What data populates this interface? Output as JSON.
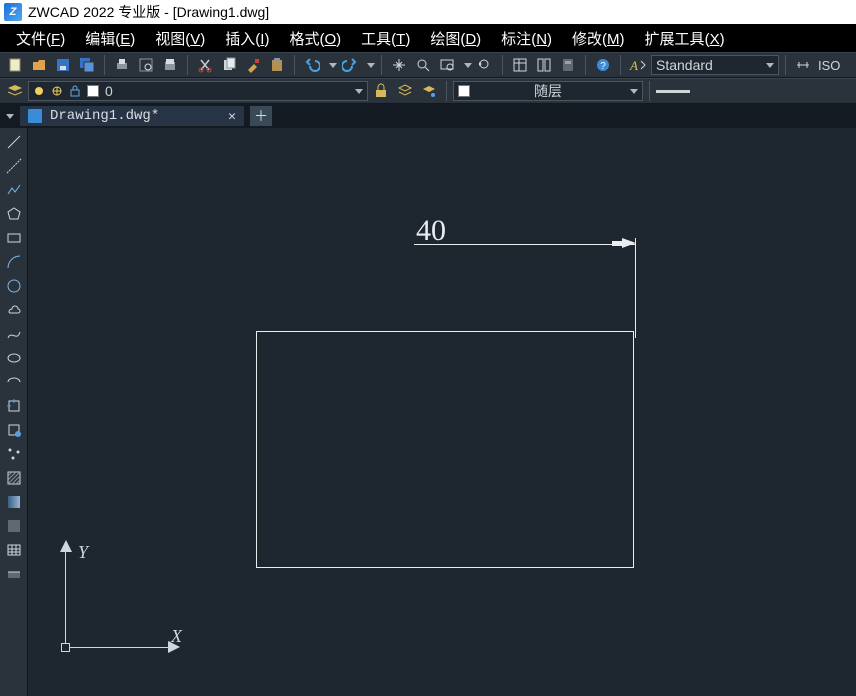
{
  "title": "ZWCAD 2022 专业版 - [Drawing1.dwg]",
  "menu": {
    "file": {
      "label": "文件",
      "accel": "F"
    },
    "edit": {
      "label": "编辑",
      "accel": "E"
    },
    "view": {
      "label": "视图",
      "accel": "V"
    },
    "insert": {
      "label": "插入",
      "accel": "I"
    },
    "format": {
      "label": "格式",
      "accel": "O"
    },
    "tools": {
      "label": "工具",
      "accel": "T"
    },
    "draw": {
      "label": "绘图",
      "accel": "D"
    },
    "annot": {
      "label": "标注",
      "accel": "N"
    },
    "modify": {
      "label": "修改",
      "accel": "M"
    },
    "ext": {
      "label": "扩展工具",
      "accel": "X"
    }
  },
  "toolbar1": {
    "style_label": "Standard",
    "iso_label": "ISO"
  },
  "toolbar2": {
    "layer0": "0",
    "bylayer": "随层"
  },
  "tab": {
    "filename": "Drawing1.dwg*"
  },
  "drawing": {
    "dimension_value": "40"
  },
  "ucs": {
    "x": "X",
    "y": "Y"
  },
  "icons": {
    "new": "new-file-icon",
    "open": "open-icon",
    "save": "save-icon",
    "saveall": "save-all-icon",
    "print": "print-icon",
    "preview": "print-preview-icon",
    "publish": "publish-icon",
    "cut": "cut-icon",
    "copy": "copy-icon",
    "matchprop": "match-prop-icon",
    "paste": "paste-icon",
    "undo": "undo-icon",
    "redo": "redo-icon",
    "pan": "pan-icon",
    "zoomrt": "zoom-realtime-icon",
    "zoomwin": "zoom-window-icon",
    "zoomprev": "zoom-previous-icon",
    "props": "properties-icon",
    "tool": "tool-palette-icon",
    "calc": "calculator-icon",
    "help": "help-icon",
    "textstyle": "text-style-picker-icon",
    "layermgr": "layer-manager-icon",
    "sun": "layer-on-icon",
    "freeze": "layer-freeze-icon",
    "lock": "layer-lock-icon",
    "color": "layer-color-swatch",
    "lock2": "layer-locked-icon",
    "layeriso": "layer-iso-icon",
    "layermatch": "layer-match-icon",
    "line": "line-tool-icon",
    "construction": "construction-line-icon",
    "polyline": "polyline-tool-icon",
    "polygon": "polygon-tool-icon",
    "rectangle": "rectangle-tool-icon",
    "arc": "arc-tool-icon",
    "circle": "circle-tool-icon",
    "revcloud": "revision-cloud-icon",
    "spline": "spline-tool-icon",
    "ellipse": "ellipse-tool-icon",
    "ellipsearc": "ellipse-arc-tool-icon",
    "insertblock": "insert-block-icon",
    "makeblock": "make-block-icon",
    "point": "point-tool-icon",
    "hatch": "hatch-tool-icon",
    "gradient": "gradient-tool-icon",
    "region": "region-tool-icon",
    "table": "table-tool-icon",
    "wipeout": "wipeout-tool-icon"
  }
}
